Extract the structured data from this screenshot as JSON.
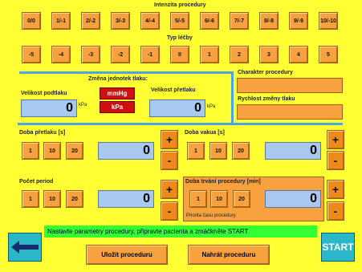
{
  "intensity": {
    "title": "Intenzita procedury",
    "buttons": [
      "0/0",
      "1/-1",
      "2/-2",
      "3/-3",
      "4/-4",
      "5/-5",
      "6/-6",
      "7/-7",
      "8/-8",
      "9/-9",
      "10/-10"
    ]
  },
  "therapy_type": {
    "title": "Typ léčby",
    "buttons": [
      "-5",
      "-4",
      "-3",
      "-2",
      "-1",
      "0",
      "1",
      "2",
      "3",
      "4",
      "5"
    ]
  },
  "pressure_units": {
    "title": "Změna jednotek tlaku:",
    "mmhg": "mmHg",
    "kpa": "kPa"
  },
  "underpressure": {
    "label": "Velikost podtlaku",
    "value": "0",
    "unit": "kPa"
  },
  "overpressure": {
    "label": "Velikost přetlaku",
    "value": "0",
    "unit": "kPa"
  },
  "character": {
    "label": "Charakter procedury"
  },
  "speed": {
    "label": "Rychlost změny tlaku"
  },
  "overpressure_time": {
    "label": "Doba přetlaku [s]",
    "presets": [
      "1",
      "10",
      "20"
    ],
    "value": "0",
    "plus": "+",
    "minus": "-"
  },
  "vacuum_time": {
    "label": "Doba vakua [s]",
    "presets": [
      "1",
      "10",
      "20"
    ],
    "value": "0",
    "plus": "+",
    "minus": "-"
  },
  "periods": {
    "label": "Počet period",
    "presets": [
      "1",
      "10",
      "20"
    ],
    "value": "0",
    "plus": "+",
    "minus": "-"
  },
  "duration": {
    "label": "Doba trvání procedury [min]",
    "presets": [
      "1",
      "10",
      "20"
    ],
    "value": "0",
    "note": "Priorita času procedury",
    "plus": "+",
    "minus": "-"
  },
  "status": "Nastavte parametry procedury, připravte pacienta a zmáčkněte START",
  "actions": {
    "save": "Uložit proceduru",
    "load": "Nahrát proceduru",
    "start": "START"
  }
}
